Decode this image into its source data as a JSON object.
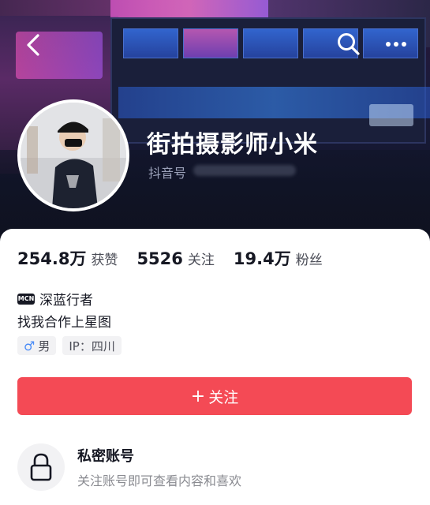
{
  "header": {
    "back_icon": "chevron-left-icon",
    "search_icon": "search-icon",
    "more_icon": "more-horizontal-icon"
  },
  "profile": {
    "name": "街拍摄影师小米",
    "douyin_id_label": "抖音号"
  },
  "stats": [
    {
      "value": "254.8万",
      "label": "获赞"
    },
    {
      "value": "5526",
      "label": "关注"
    },
    {
      "value": "19.4万",
      "label": "粉丝"
    }
  ],
  "mcn": {
    "badge": "MCN",
    "name": "深蓝行者"
  },
  "bio": "找我合作上星图",
  "tags": {
    "gender_symbol": "♂",
    "gender": "男",
    "ip": "IP：四川"
  },
  "follow_button": {
    "plus": "+",
    "label": "关注"
  },
  "private_account": {
    "icon": "lock-icon",
    "title": "私密账号",
    "description": "关注账号即可查看内容和喜欢"
  },
  "colors": {
    "follow_button": "#f44a55",
    "text_primary": "#161823",
    "text_secondary": "#8a8b91",
    "gender_male": "#4a8cf7"
  }
}
